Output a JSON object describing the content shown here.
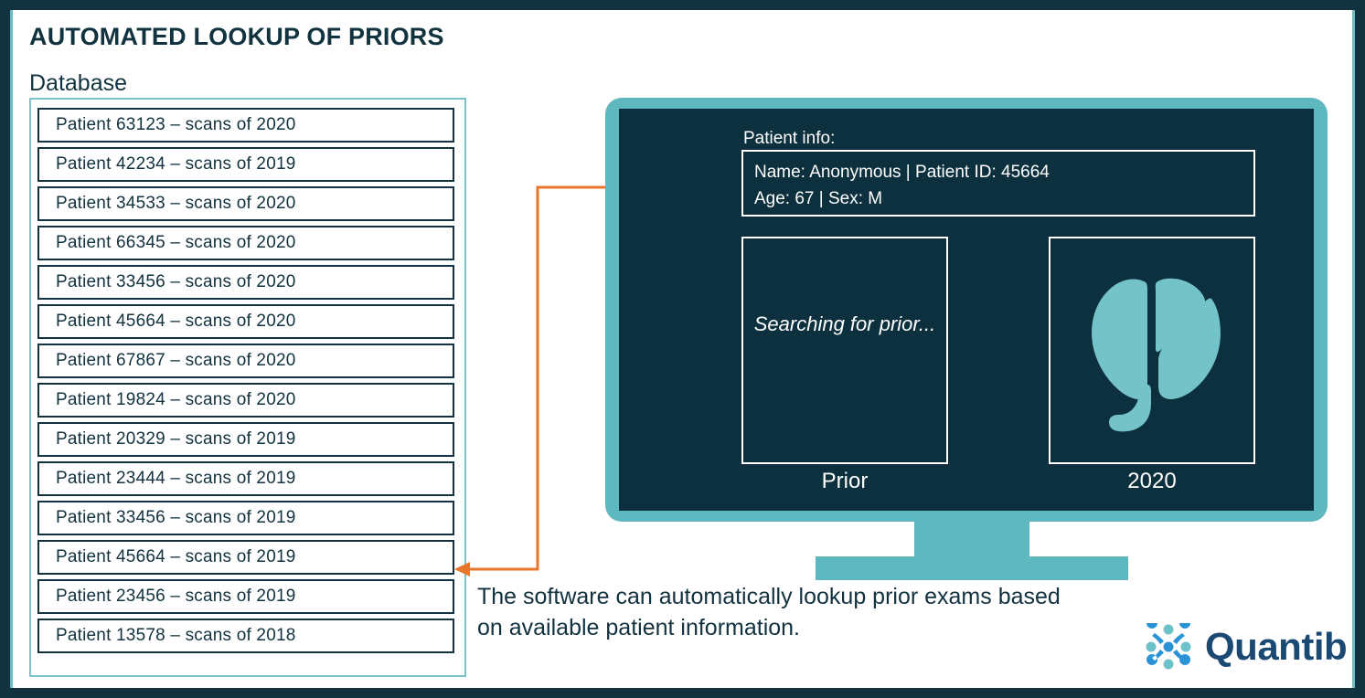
{
  "page": {
    "title": "AUTOMATED LOOKUP OF PRIORS",
    "database_label": "Database",
    "caption": "The software can automatically lookup prior exams based on available patient information.",
    "accent_teal": "#5eb8bf",
    "dark_navy": "#12323f",
    "arrow_orange": "#e8762c",
    "logo_blue": "#1a4a73"
  },
  "database": {
    "rows": [
      {
        "label": "Patient 63123 – scans of 2020"
      },
      {
        "label": "Patient 42234 – scans of 2019"
      },
      {
        "label": "Patient 34533 – scans of 2020"
      },
      {
        "label": "Patient 66345 – scans of 2020"
      },
      {
        "label": "Patient 33456 – scans of 2020"
      },
      {
        "label": "Patient 45664 – scans of 2020"
      },
      {
        "label": "Patient 67867 – scans of 2020"
      },
      {
        "label": "Patient 19824 – scans of 2020"
      },
      {
        "label": "Patient 20329 – scans of 2019"
      },
      {
        "label": "Patient 23444 – scans of 2019"
      },
      {
        "label": "Patient 33456 – scans of 2019"
      },
      {
        "label": "Patient 45664 – scans of 2019"
      },
      {
        "label": "Patient 23456 – scans of 2019"
      },
      {
        "label": "Patient 13578 – scans of 2018"
      }
    ],
    "highlighted_row_index": 11
  },
  "monitor": {
    "patient_info_label": "Patient info:",
    "patient_info_line1": "Name: Anonymous  |  Patient ID: 45664",
    "patient_info_line2": "Age: 67  |  Sex: M",
    "panels": [
      {
        "caption": "Prior",
        "status": "Searching for prior...",
        "has_image": false
      },
      {
        "caption": "2020",
        "status": "",
        "has_image": true
      }
    ]
  },
  "logo": {
    "text": "Quantib",
    "mark_name": "quantib-network-mark"
  }
}
